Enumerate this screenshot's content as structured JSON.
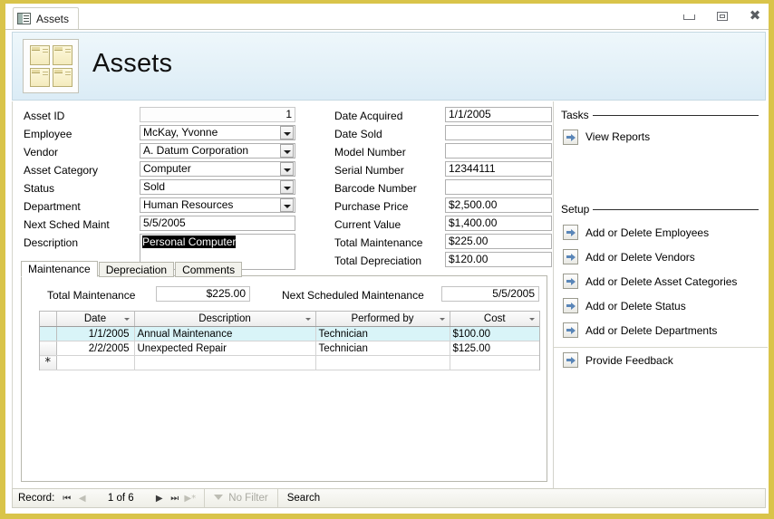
{
  "window": {
    "tab_title": "Assets",
    "tab_icon": "table-icon",
    "controls": [
      {
        "name": "minimize-button",
        "glyph": "minimize-icon"
      },
      {
        "name": "restore-button",
        "glyph": "restore-icon"
      },
      {
        "name": "close-button",
        "glyph": "close-icon"
      }
    ]
  },
  "banner": {
    "title": "Assets",
    "logo_icon": "assets-folders-icon"
  },
  "form": {
    "left_fields": [
      {
        "label": "Asset ID",
        "value": "1",
        "type": "readonly"
      },
      {
        "label": "Employee",
        "value": "McKay, Yvonne",
        "type": "combo"
      },
      {
        "label": "Vendor",
        "value": "A. Datum Corporation",
        "type": "combo"
      },
      {
        "label": "Asset Category",
        "value": "Computer",
        "type": "combo"
      },
      {
        "label": "Status",
        "value": "Sold",
        "type": "combo"
      },
      {
        "label": "Department",
        "value": "Human Resources",
        "type": "combo"
      },
      {
        "label": "Next Sched Maint",
        "value": "5/5/2005",
        "type": "text"
      }
    ],
    "description": {
      "label": "Description",
      "value": "Personal Computer",
      "selected": true
    },
    "mid_fields": [
      {
        "label": "Date Acquired",
        "value": "1/1/2005"
      },
      {
        "label": "Date Sold",
        "value": ""
      },
      {
        "label": "Model Number",
        "value": ""
      },
      {
        "label": "Serial Number",
        "value": "12344111"
      },
      {
        "label": "Barcode Number",
        "value": ""
      },
      {
        "label": "Purchase Price",
        "value": "$2,500.00"
      },
      {
        "label": "Current Value",
        "value": "$1,400.00"
      },
      {
        "label": "Total Maintenance",
        "value": "$225.00"
      },
      {
        "label": "Total Depreciation",
        "value": "$120.00"
      }
    ]
  },
  "tabs": [
    {
      "label": "Maintenance",
      "active": true
    },
    {
      "label": "Depreciation",
      "active": false
    },
    {
      "label": "Comments",
      "active": false
    }
  ],
  "subform": {
    "total_maintenance_label": "Total Maintenance",
    "total_maintenance_value": "$225.00",
    "next_scheduled_label": "Next Scheduled Maintenance",
    "next_scheduled_value": "5/5/2005",
    "columns": [
      "Date",
      "Description",
      "Performed by",
      "Cost"
    ],
    "rows": [
      {
        "date": "1/1/2005",
        "description": "Annual Maintenance",
        "performed_by": "Technician",
        "cost": "$100.00",
        "selected": true
      },
      {
        "date": "2/2/2005",
        "description": "Unexpected Repair",
        "performed_by": "Technician",
        "cost": "$125.00",
        "selected": false
      }
    ],
    "new_row_marker": "*"
  },
  "sidebar": {
    "tasks": {
      "title": "Tasks",
      "items": [
        {
          "label": "View Reports",
          "icon": "arrow-action-icon"
        }
      ]
    },
    "setup": {
      "title": "Setup",
      "items": [
        {
          "label": "Add or Delete Employees",
          "icon": "arrow-action-icon"
        },
        {
          "label": "Add or Delete Vendors",
          "icon": "arrow-action-icon"
        },
        {
          "label": "Add or Delete Asset Categories",
          "icon": "arrow-action-icon"
        },
        {
          "label": "Add or Delete Status",
          "icon": "arrow-action-icon"
        },
        {
          "label": "Add or Delete Departments",
          "icon": "arrow-action-icon"
        }
      ]
    },
    "feedback": {
      "label": "Provide Feedback",
      "icon": "arrow-action-icon"
    }
  },
  "statusbar": {
    "record_label": "Record:",
    "record_position": "1 of 6",
    "nav_first": "first-record-icon",
    "nav_prev": "previous-record-icon",
    "nav_next": "next-record-icon",
    "nav_last": "last-record-icon",
    "nav_new": "new-record-icon",
    "filter_label": "No Filter",
    "search_label": "Search"
  },
  "colors": {
    "window_border": "#d9c44a",
    "banner_bg": "#e4f1f8",
    "row_selected": "#d9f4f8",
    "text_selection": "#000000"
  }
}
